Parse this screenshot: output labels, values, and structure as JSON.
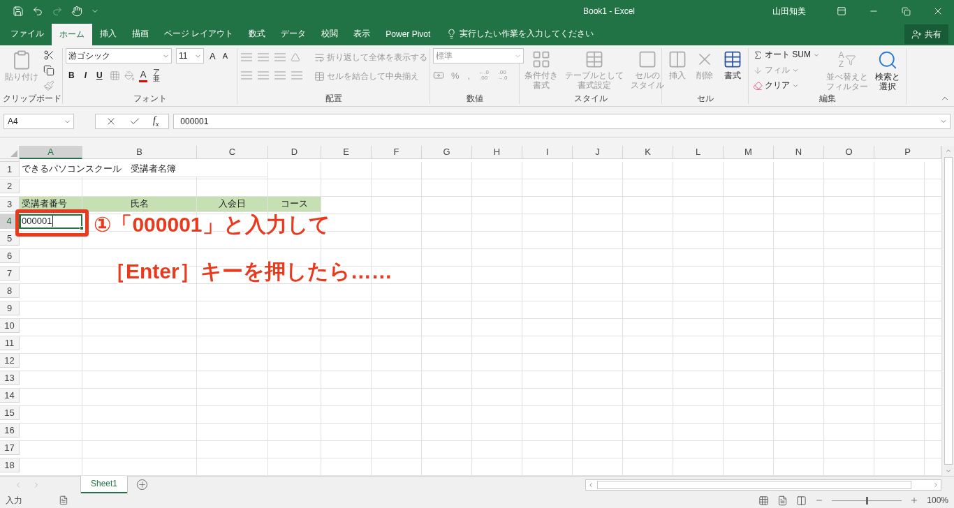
{
  "title_bar": {
    "title": "Book1 - Excel",
    "user": "山田知美"
  },
  "ribbon_tabs": [
    {
      "label": "ファイル",
      "selected": false
    },
    {
      "label": "ホーム",
      "selected": true
    },
    {
      "label": "挿入",
      "selected": false
    },
    {
      "label": "描画",
      "selected": false
    },
    {
      "label": "ページ レイアウト",
      "selected": false
    },
    {
      "label": "数式",
      "selected": false
    },
    {
      "label": "データ",
      "selected": false
    },
    {
      "label": "校閲",
      "selected": false
    },
    {
      "label": "表示",
      "selected": false
    },
    {
      "label": "Power Pivot",
      "selected": false
    }
  ],
  "tell_me": {
    "placeholder": "実行したい作業を入力してください"
  },
  "share_button": "共有",
  "ribbon_groups": [
    {
      "kind": "clipboard",
      "label": "クリップボード",
      "paste": {
        "label": "貼り付け",
        "disabled": true
      }
    },
    {
      "kind": "font",
      "label": "フォント",
      "font_name": "游ゴシック",
      "font_size": "11",
      "grow_glyph": "A",
      "shrink_glyph": "A",
      "style_buttons": [
        "B",
        "I",
        "U"
      ],
      "font_color_glyph": "A",
      "phonetic_glyphs": [
        "ア",
        "亜"
      ]
    },
    {
      "kind": "alignment",
      "label": "配置",
      "wrap": {
        "label": "折り返して全体を表示する",
        "disabled": true
      },
      "merge": {
        "label": "セルを結合して中央揃え",
        "disabled": true
      }
    },
    {
      "kind": "number",
      "label": "数値",
      "format": {
        "value": "標準",
        "disabled": true
      },
      "percent": "%",
      "comma": ",",
      "increase_decimal": [
        "←.0",
        ".00"
      ],
      "decrease_decimal": [
        ".00",
        "→.0"
      ]
    },
    {
      "kind": "styles",
      "label": "スタイル",
      "buttons": [
        {
          "lines": [
            "条件付き",
            "書式"
          ],
          "disabled": true
        },
        {
          "lines": [
            "テーブルとして",
            "書式設定"
          ],
          "disabled": true
        },
        {
          "lines": [
            "セルの",
            "スタイル"
          ],
          "disabled": true
        }
      ]
    },
    {
      "kind": "cells",
      "label": "セル",
      "buttons": [
        {
          "lines": [
            "挿入"
          ],
          "disabled": true
        },
        {
          "lines": [
            "削除"
          ],
          "disabled": true
        },
        {
          "lines": [
            "書式"
          ],
          "disabled": false
        }
      ]
    },
    {
      "kind": "editing",
      "label": "編集",
      "small_buttons": [
        {
          "label": "オート SUM",
          "disabled": false
        },
        {
          "label": "フィル",
          "disabled": true
        },
        {
          "label": "クリア",
          "disabled": false
        }
      ],
      "sort_glyphs": [
        "A",
        "Z"
      ],
      "buttons": [
        {
          "lines": [
            "並べ替えと",
            "フィルター"
          ],
          "disabled": true
        },
        {
          "lines": [
            "検索と",
            "選択"
          ],
          "disabled": false
        }
      ]
    }
  ],
  "formula_bar": {
    "name_box": "A4",
    "fx_glyphs": [
      "f",
      "x"
    ],
    "formula": "000001"
  },
  "columns": [
    {
      "label": "A",
      "selected": true
    },
    {
      "label": "B",
      "selected": false
    },
    {
      "label": "C",
      "selected": false
    },
    {
      "label": "D",
      "selected": false
    },
    {
      "label": "E",
      "selected": false
    },
    {
      "label": "F",
      "selected": false
    },
    {
      "label": "G",
      "selected": false
    },
    {
      "label": "H",
      "selected": false
    },
    {
      "label": "I",
      "selected": false
    },
    {
      "label": "J",
      "selected": false
    },
    {
      "label": "K",
      "selected": false
    },
    {
      "label": "L",
      "selected": false
    },
    {
      "label": "M",
      "selected": false
    },
    {
      "label": "N",
      "selected": false
    },
    {
      "label": "O",
      "selected": false
    },
    {
      "label": "P",
      "selected": false
    }
  ],
  "rows": [
    {
      "label": "1",
      "selected": false,
      "cells": [
        {
          "text": "できるパソコンスクール　受講者名簿",
          "centered": false,
          "filled": false,
          "selected": false
        }
      ]
    },
    {
      "label": "2",
      "selected": false
    },
    {
      "label": "3",
      "selected": false,
      "cells": [
        {
          "text": "受講者番号",
          "centered": false,
          "filled": true,
          "selected": false
        },
        {
          "text": "氏名",
          "centered": true,
          "filled": true,
          "selected": false
        },
        {
          "text": "入会日",
          "centered": true,
          "filled": true,
          "selected": false
        },
        {
          "text": "コース",
          "centered": true,
          "filled": true,
          "selected": false
        }
      ]
    },
    {
      "label": "4",
      "selected": true,
      "cells": [
        {
          "text": "000001",
          "centered": false,
          "filled": false,
          "selected": true
        }
      ]
    },
    {
      "label": "5",
      "selected": false
    },
    {
      "label": "6",
      "selected": false
    },
    {
      "label": "7",
      "selected": false
    },
    {
      "label": "8",
      "selected": false
    },
    {
      "label": "9",
      "selected": false
    },
    {
      "label": "10",
      "selected": false
    },
    {
      "label": "11",
      "selected": false
    },
    {
      "label": "12",
      "selected": false
    },
    {
      "label": "13",
      "selected": false
    },
    {
      "label": "14",
      "selected": false
    },
    {
      "label": "15",
      "selected": false
    },
    {
      "label": "16",
      "selected": false
    },
    {
      "label": "17",
      "selected": false
    },
    {
      "label": "18",
      "selected": false
    }
  ],
  "annotation": {
    "lines": [
      "①「000001」と入力して",
      "［Enter］キーを押したら……"
    ]
  },
  "sheet_tabs": [
    {
      "label": "Sheet1",
      "selected": true
    }
  ],
  "status_bar": {
    "mode": "入力",
    "zoom": "100%",
    "zoom_level": {
      "level": 0.5
    }
  }
}
